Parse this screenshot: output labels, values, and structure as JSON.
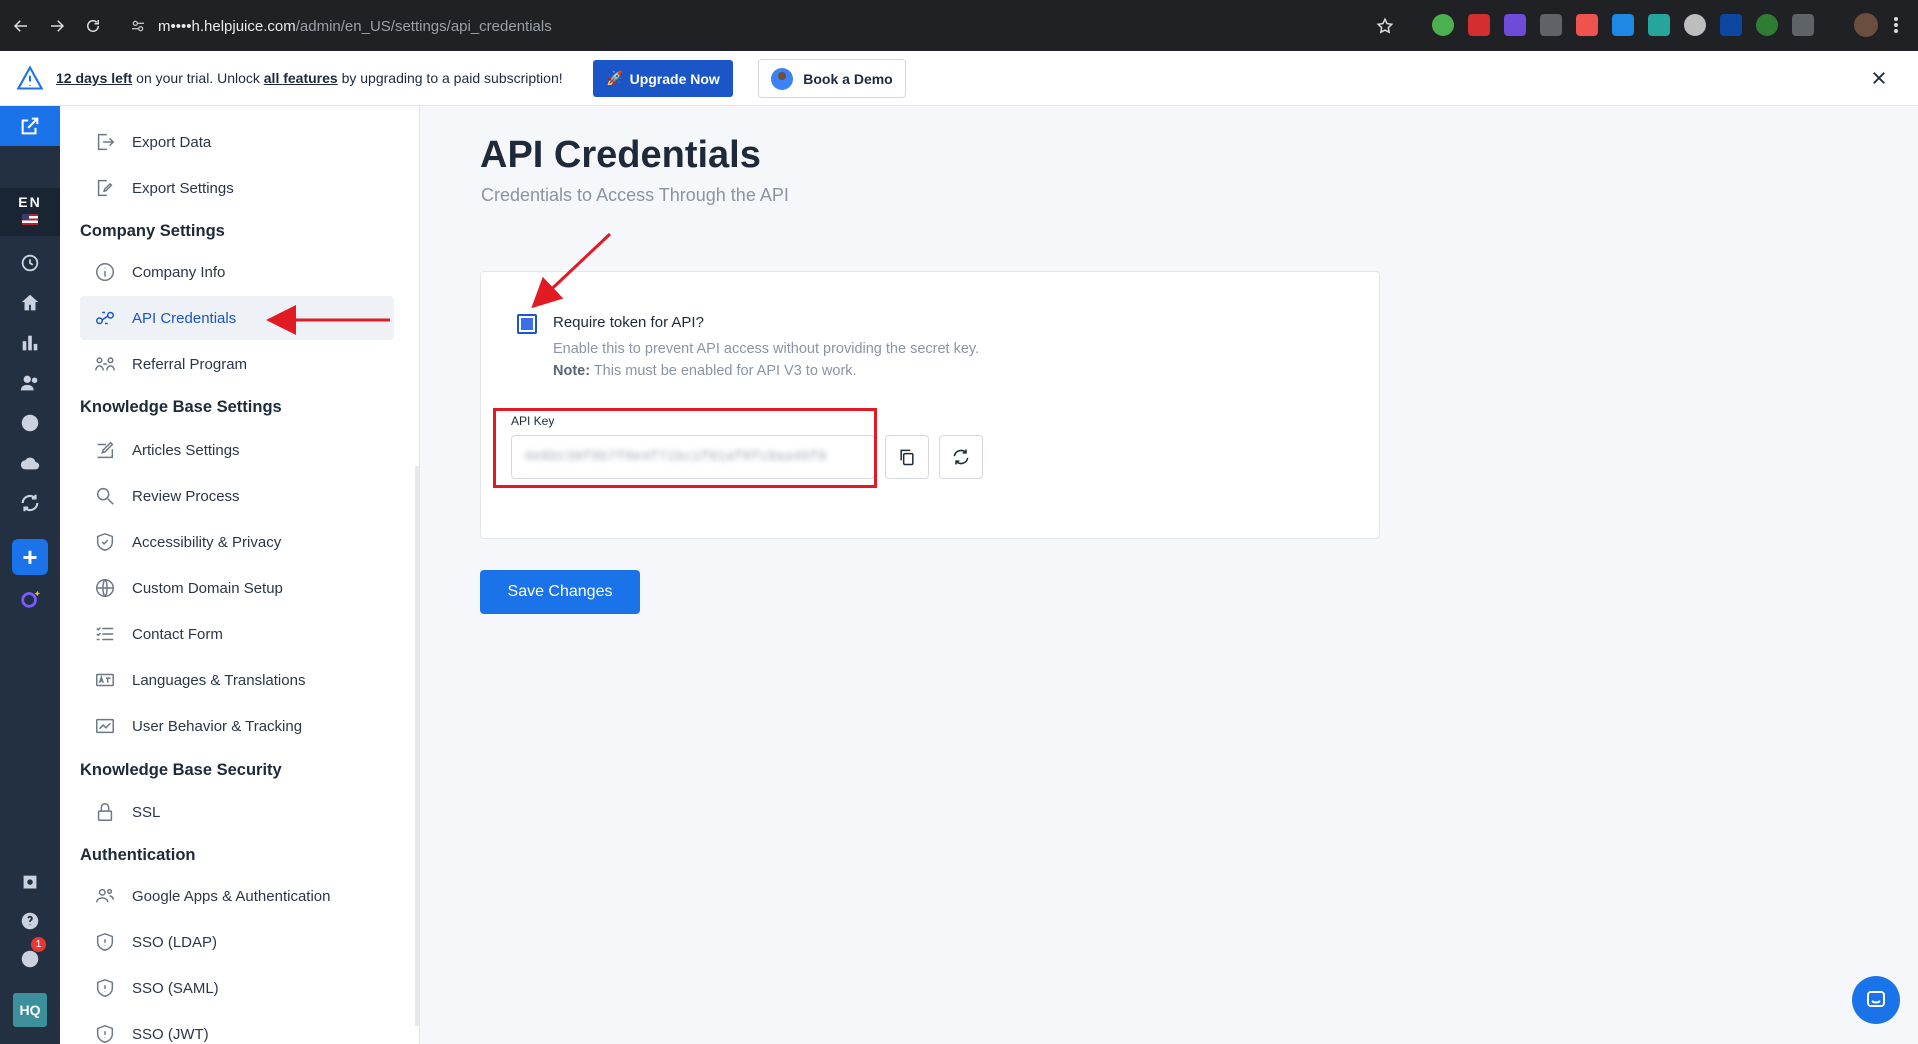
{
  "browser": {
    "url_host": "helpjuice.com",
    "url_prefix": "m••••h.",
    "url_path": "/admin/en_US/settings/api_credentials"
  },
  "banner": {
    "trial_days": "12 days left",
    "text_1": " on your trial. Unlock ",
    "features_link": "all features",
    "text_2": " by upgrading to a paid subscription!",
    "upgrade_label": "Upgrade Now",
    "demo_label": "Book a Demo"
  },
  "rail": {
    "language_code": "EN",
    "notification_count": "1",
    "workspace_initials": "HQ"
  },
  "sidebar": {
    "items_top": [
      {
        "label": "Export Data",
        "icon": "export-icon"
      },
      {
        "label": "Export Settings",
        "icon": "export-settings-icon"
      }
    ],
    "company_heading": "Company Settings",
    "company_items": [
      {
        "label": "Company Info",
        "icon": "info-icon"
      },
      {
        "label": "API Credentials",
        "icon": "link-icon"
      },
      {
        "label": "Referral Program",
        "icon": "referral-icon"
      }
    ],
    "kb_heading": "Knowledge Base Settings",
    "kb_items": [
      {
        "label": "Articles Settings",
        "icon": "edit-icon"
      },
      {
        "label": "Review Process",
        "icon": "search-icon"
      },
      {
        "label": "Accessibility & Privacy",
        "icon": "shield-icon"
      },
      {
        "label": "Custom Domain Setup",
        "icon": "globe-icon"
      },
      {
        "label": "Contact Form",
        "icon": "list-icon"
      },
      {
        "label": "Languages & Translations",
        "icon": "translate-icon"
      },
      {
        "label": "User Behavior & Tracking",
        "icon": "tracking-icon"
      }
    ],
    "security_heading": "Knowledge Base Security",
    "security_items": [
      {
        "label": "SSL",
        "icon": "lock-icon"
      }
    ],
    "auth_heading": "Authentication",
    "auth_items": [
      {
        "label": "Google Apps & Authentication",
        "icon": "users-icon"
      },
      {
        "label": "SSO (LDAP)",
        "icon": "shield-icon"
      },
      {
        "label": "SSO (SAML)",
        "icon": "shield-icon"
      },
      {
        "label": "SSO (JWT)",
        "icon": "shield-icon"
      }
    ]
  },
  "main": {
    "title": "API Credentials",
    "subtitle": "Credentials to Access Through the API",
    "require_token_label": "Require token for API?",
    "require_token_help": "Enable this to prevent API access without providing the secret key.",
    "note_label": "Note:",
    "note_text": " This must be enabled for API V3 to work.",
    "api_key_label": "API Key",
    "api_key_value": "4e8bc39f0b7f0e4f71bc1f01af0fc0aa46f0",
    "save_label": "Save Changes"
  },
  "colors": {
    "accent": "#1a73e8",
    "annotation": "#e01b24",
    "rail": "#223041"
  }
}
